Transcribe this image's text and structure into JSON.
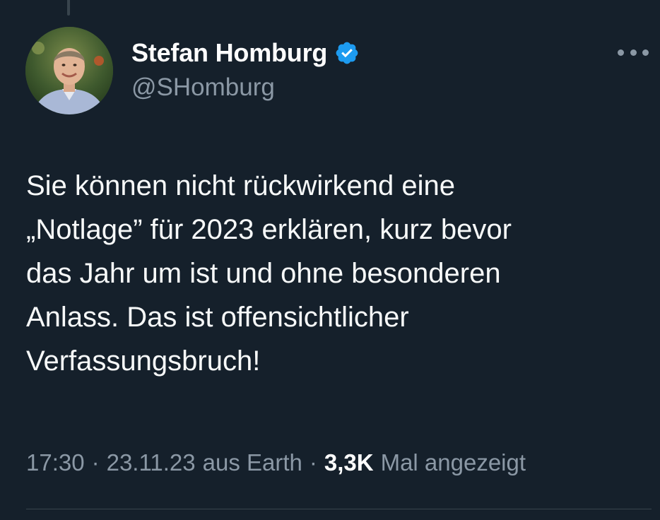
{
  "author": {
    "display_name": "Stefan Homburg",
    "handle": "@SHomburg",
    "verified_icon": "verified-badge-icon",
    "avatar_icon": "avatar-photo"
  },
  "tweet": {
    "text": "Sie können nicht rückwirkend eine\n„Notlage” für 2023 erklären, kurz bevor\ndas Jahr um ist und ohne besonderen\nAnlass. Das ist offensichtlicher\nVerfassungsbruch!",
    "time": "17:30",
    "date": "23.11.23",
    "source": "aus Earth",
    "views_count": "3,3K",
    "views_label": "Mal angezeigt",
    "separator": "·"
  },
  "menu": {
    "more_icon": "more-horizontal-icon"
  },
  "colors": {
    "background": "#15202b",
    "primary_text": "#f7f9f9",
    "secondary_text": "#8b98a5",
    "verified_blue": "#1d9bf0",
    "divider": "#38444d"
  }
}
